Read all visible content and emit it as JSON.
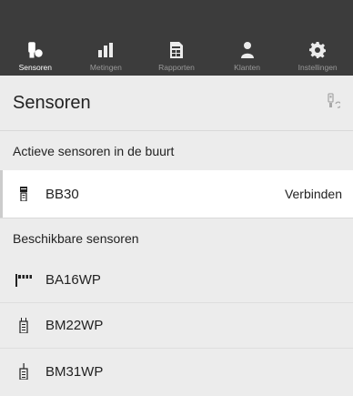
{
  "nav": {
    "tabs": [
      {
        "label": "Sensoren",
        "icon": "sensor-icon",
        "active": true
      },
      {
        "label": "Metingen",
        "icon": "bar-chart-icon",
        "active": false
      },
      {
        "label": "Rapporten",
        "icon": "report-icon",
        "active": false
      },
      {
        "label": "Klanten",
        "icon": "customers-icon",
        "active": false
      },
      {
        "label": "Instellingen",
        "icon": "gear-icon",
        "active": false
      }
    ]
  },
  "header": {
    "title": "Sensoren",
    "action_icon": "sensor-sync-icon"
  },
  "nearby": {
    "heading": "Actieve sensoren in de buurt",
    "items": [
      {
        "name": "BB30",
        "action": "Verbinden",
        "icon": "probe-sensor-icon"
      }
    ]
  },
  "available": {
    "heading": "Beschikbare sensoren",
    "items": [
      {
        "name": "BA16WP",
        "icon": "multi-probe-icon"
      },
      {
        "name": "BM22WP",
        "icon": "moisture-meter-icon"
      },
      {
        "name": "BM31WP",
        "icon": "pin-meter-icon"
      }
    ]
  },
  "colors": {
    "nav_bg": "#3c3c3c",
    "page_bg": "#ececec",
    "active_tab": "#ffffff",
    "inactive_tab": "#9a9a9a"
  }
}
